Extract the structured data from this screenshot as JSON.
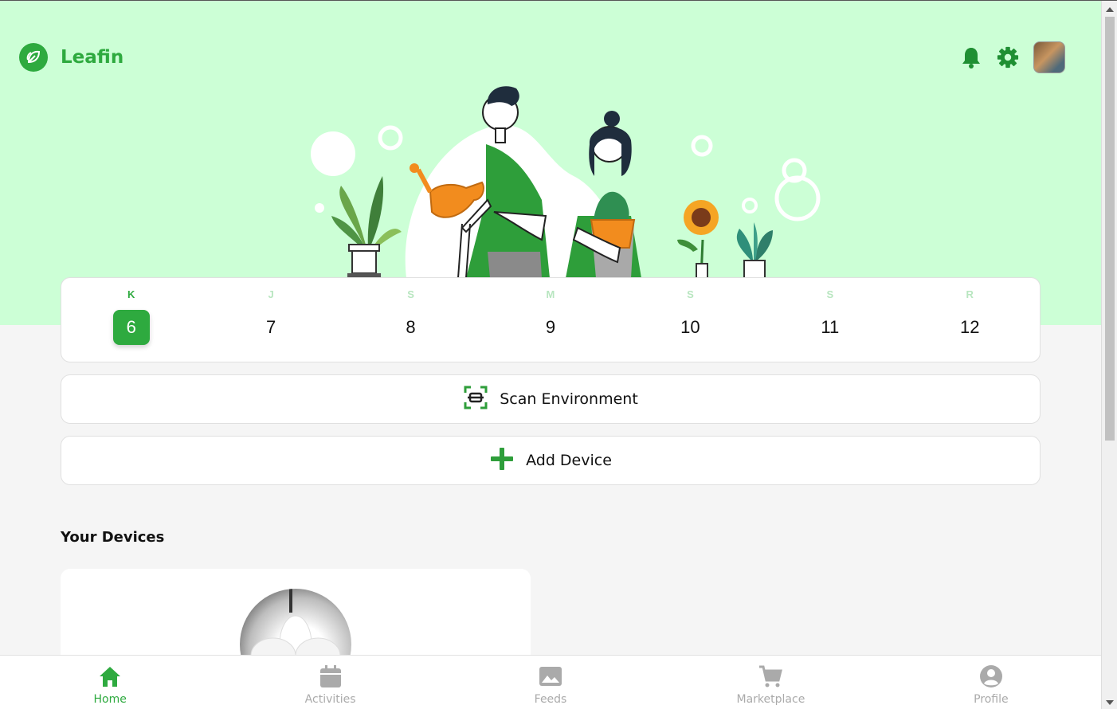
{
  "app": {
    "name": "Leafin"
  },
  "header": {
    "icons": [
      "bell-icon",
      "gear-icon",
      "avatar"
    ]
  },
  "calendar": {
    "days": [
      {
        "letter": "K",
        "number": "6",
        "active": true
      },
      {
        "letter": "J",
        "number": "7"
      },
      {
        "letter": "S",
        "number": "8"
      },
      {
        "letter": "M",
        "number": "9"
      },
      {
        "letter": "S",
        "number": "10"
      },
      {
        "letter": "S",
        "number": "11"
      },
      {
        "letter": "R",
        "number": "12"
      }
    ]
  },
  "actions": {
    "scan_label": "Scan Environment",
    "add_label": "Add Device"
  },
  "devices": {
    "title": "Your Devices"
  },
  "nav": {
    "items": [
      {
        "label": "Home",
        "icon": "home-icon",
        "active": true
      },
      {
        "label": "Activities",
        "icon": "calendar-icon"
      },
      {
        "label": "Feeds",
        "icon": "image-icon"
      },
      {
        "label": "Marketplace",
        "icon": "cart-icon"
      },
      {
        "label": "Profile",
        "icon": "profile-icon"
      }
    ]
  },
  "colors": {
    "brand": "#2eaa3f",
    "hero_bg": "#ccffd6",
    "muted": "#aaaaaa"
  }
}
